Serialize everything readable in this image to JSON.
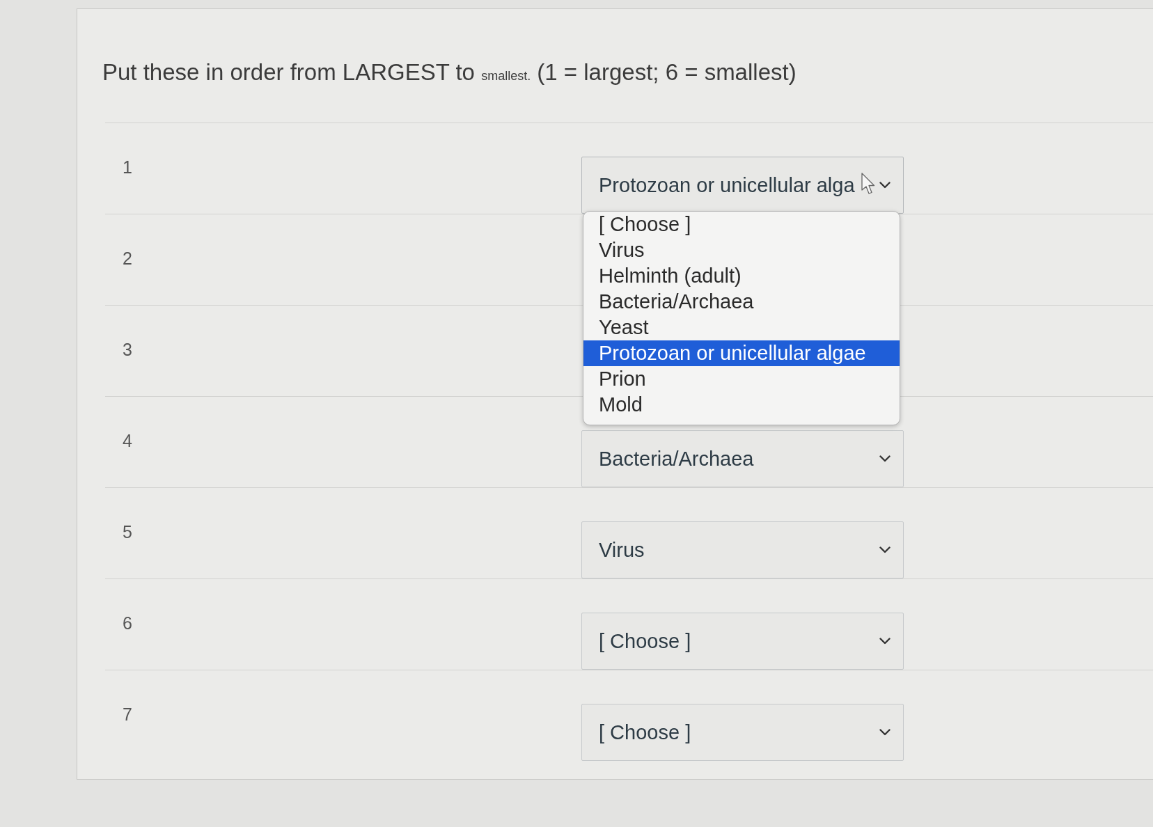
{
  "question": {
    "parts": [
      {
        "text": "Put these in order from LARGEST to",
        "kind": "plain"
      },
      {
        "text": "smallest.",
        "kind": "small"
      },
      {
        "text": "(1 = largest; 6 = smallest)",
        "kind": "plain"
      }
    ]
  },
  "rows": [
    {
      "number": "1",
      "answer": {
        "value": "Protozoan or unicellular alga",
        "expanded": true,
        "options": [
          {
            "label": "[ Choose ]",
            "selected": false
          },
          {
            "label": "Virus",
            "selected": false
          },
          {
            "label": "Helminth (adult)",
            "selected": false
          },
          {
            "label": "Bacteria/Archaea",
            "selected": false
          },
          {
            "label": "Yeast",
            "selected": false
          },
          {
            "label": "Protozoan or unicellular algae",
            "selected": true
          },
          {
            "label": "Prion",
            "selected": false
          },
          {
            "label": "Mold",
            "selected": false
          }
        ]
      }
    },
    {
      "number": "2"
    },
    {
      "number": "3"
    },
    {
      "number": "4",
      "answer": {
        "value": "Bacteria/Archaea",
        "expanded": false
      }
    },
    {
      "number": "5",
      "answer": {
        "value": "Virus",
        "expanded": false
      }
    },
    {
      "number": "6",
      "answer": {
        "value": "[ Choose ]",
        "expanded": false
      }
    },
    {
      "number": "7",
      "answer": {
        "value": "[ Choose ]",
        "expanded": false
      }
    }
  ]
}
